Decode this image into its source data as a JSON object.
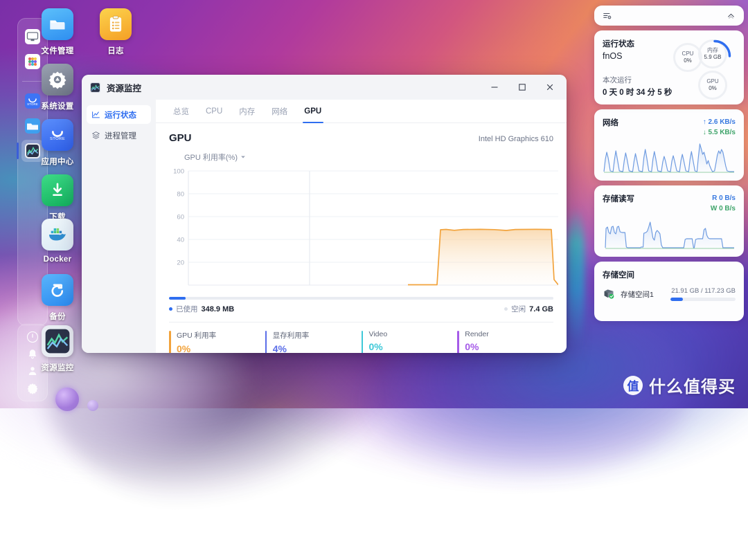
{
  "desktop": {
    "dock": {
      "top_group": [
        {
          "name": "display-icon",
          "label": "显示器"
        },
        {
          "name": "apps-grid-icon",
          "label": "应用"
        }
      ],
      "bottom_group": [
        {
          "name": "app-store-icon",
          "label": "应用中心"
        },
        {
          "name": "file-manager-icon",
          "label": "文件管理"
        },
        {
          "name": "resource-monitor-icon",
          "label": "资源监控",
          "active": true
        }
      ]
    },
    "tray": [
      {
        "name": "power-icon",
        "label": "电源"
      },
      {
        "name": "bell-icon",
        "label": "通知"
      },
      {
        "name": "user-icon",
        "label": "用户"
      },
      {
        "name": "gear-icon",
        "label": "设置"
      }
    ],
    "icons": [
      {
        "label": "文件管理",
        "icon": "folder-icon",
        "color": "#3ea0f0"
      },
      {
        "label": "日志",
        "icon": "clipboard-icon",
        "color": "#f9b233"
      },
      {
        "label": "系统设置",
        "icon": "gear-icon",
        "color": "#7b8494"
      },
      {
        "label": "应用中心",
        "icon": "store-icon",
        "color": "#3d74f5"
      },
      {
        "label": "下载",
        "icon": "download-icon",
        "color": "#1fc069"
      },
      {
        "label": "Docker",
        "icon": "docker-whale-icon",
        "color": "#2fb3d6"
      },
      {
        "label": "备份",
        "icon": "backup-sync-icon",
        "color": "#2f9cf5"
      },
      {
        "label": "资源监控",
        "icon": "chart-monitor-icon",
        "color": "#2b3248"
      }
    ]
  },
  "window": {
    "title": "资源监控",
    "title_icon": "resource-monitor-icon",
    "controls": {
      "minimize": "–",
      "maximize": "□",
      "close": "✕"
    },
    "sidebar": [
      {
        "label": "运行状态",
        "icon": "chart-line-icon",
        "active": true
      },
      {
        "label": "进程管理",
        "icon": "layers-icon",
        "active": false
      }
    ],
    "tabs": [
      {
        "label": "总览",
        "active": false
      },
      {
        "label": "CPU",
        "active": false
      },
      {
        "label": "内存",
        "active": false
      },
      {
        "label": "网络",
        "active": false
      },
      {
        "label": "GPU",
        "active": true
      }
    ],
    "panel": {
      "title": "GPU",
      "device": "Intel HD Graphics 610",
      "metric_selector": "GPU 利用率(%)",
      "memory_bar": {
        "used_label": "已使用",
        "used_value": "348.9 MB",
        "free_label": "空闲",
        "free_value": "7.4 GB",
        "used_percent": 4.4
      },
      "stats": [
        {
          "key": "GPU 利用率",
          "value": "0%",
          "color": "#f2a33c"
        },
        {
          "key": "显存利用率",
          "value": "4%",
          "color": "#5b6ee8"
        },
        {
          "key": "Video",
          "value": "0%",
          "color": "#3ec8d8"
        },
        {
          "key": "Render",
          "value": "0%",
          "color": "#a55be8"
        }
      ]
    }
  },
  "widgets": {
    "toolbar": {
      "settings_icon": "list-settings-icon",
      "collapse_icon": "chevron-up-icon"
    },
    "status": {
      "title": "运行状态",
      "os": "fnOS",
      "uptime_label": "本次运行",
      "uptime_value": "0 天 0 时 34 分 5 秒",
      "gauges": [
        {
          "name": "CPU",
          "value": "0%",
          "percent": 0,
          "color": "#2f6ef0"
        },
        {
          "name": "内存",
          "value": "5.9 GB",
          "percent": 26,
          "color": "#2f6ef0"
        },
        {
          "name": "GPU",
          "value": "0%",
          "percent": 0,
          "color": "#2f6ef0"
        }
      ]
    },
    "network": {
      "title": "网络",
      "upload": "↑ 2.6 KB/s",
      "download": "↓ 5.5 KB/s"
    },
    "disk_io": {
      "title": "存储读写",
      "read": "R 0 B/s",
      "write": "W 0 B/s"
    },
    "storage": {
      "title": "存储空间",
      "icon": "disk-icon",
      "volume_name": "存储空间1",
      "capacity": "21.91 GB / 117.23 GB",
      "used_percent": 18.7
    }
  },
  "watermark": {
    "logo_char": "值",
    "text": "什么值得买"
  },
  "chart_data": {
    "type": "area",
    "title": "GPU 利用率(%)",
    "xlabel": "",
    "ylabel": "GPU 利用率(%)",
    "ylim": [
      0,
      100
    ],
    "yticks": [
      20,
      40,
      60,
      80,
      100
    ],
    "grid": true,
    "legend": "none",
    "line_color": "#f2a33c",
    "series": [
      {
        "name": "GPU 利用率(%)",
        "x": [
          0,
          5,
          10,
          15,
          20,
          25,
          30,
          35,
          40,
          45,
          50,
          55,
          57,
          58,
          59,
          60,
          61,
          63,
          65,
          68,
          70,
          72,
          75,
          78,
          80,
          83,
          85,
          88,
          90,
          92,
          94,
          96,
          97,
          98,
          99,
          100
        ],
        "values": [
          0,
          0,
          0,
          0,
          0,
          0,
          0,
          0,
          0,
          0,
          0,
          0,
          0,
          0,
          0,
          0,
          0,
          48,
          48,
          47,
          47.5,
          48,
          48,
          48,
          48,
          47.5,
          47,
          47.5,
          48,
          48,
          48,
          48,
          48,
          10,
          0,
          0
        ]
      }
    ]
  }
}
